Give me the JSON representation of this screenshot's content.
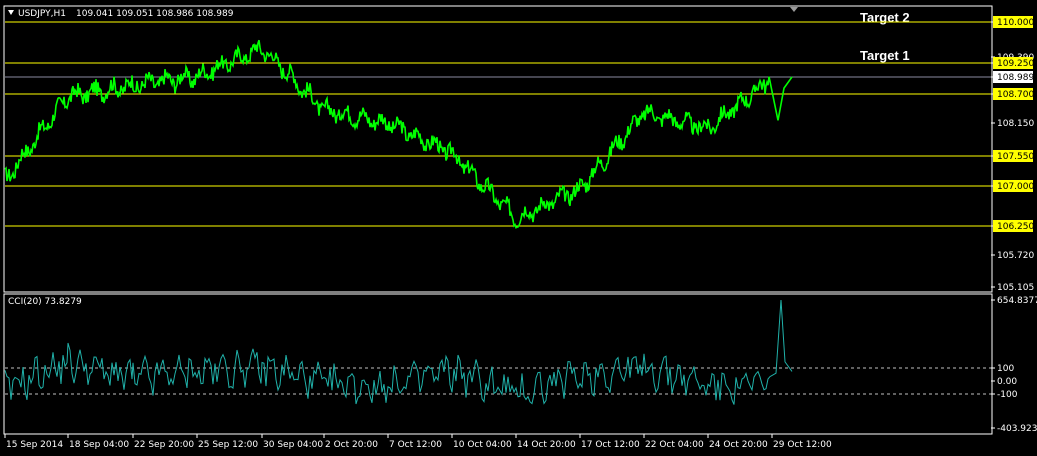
{
  "header": {
    "symbol_label": "USDJPY,H1",
    "ohlc": "109.041 109.051 108.986 108.989"
  },
  "indicator": {
    "label": "CCI(20) 73.8279"
  },
  "annotations": {
    "target1": "Target 1",
    "target2": "Target 2"
  },
  "colors": {
    "price_line": "#00ff00",
    "cci_line": "#20b2aa",
    "level_line": "#ffff00",
    "level_label_bg": "#ffff00",
    "axis": "#ffffff",
    "background": "#000000"
  },
  "chart_data": [
    {
      "type": "line",
      "title": "USDJPY,H1",
      "x": [
        "15 Sep 2014",
        "18 Sep 04:00",
        "22 Sep 20:00",
        "25 Sep 12:00",
        "30 Sep 04:00",
        "2 Oct 20:00",
        "7 Oct 12:00",
        "10 Oct 04:00",
        "14 Oct 20:00",
        "17 Oct 12:00",
        "22 Oct 04:00",
        "24 Oct 20:00",
        "29 Oct 12:00"
      ],
      "series": [
        {
          "values": [
            107.1,
            108.65,
            108.85,
            109.0,
            109.55,
            108.4,
            108.15,
            107.6,
            106.4,
            106.95,
            108.35,
            108.05,
            108.99
          ]
        }
      ],
      "ylim": [
        105.105,
        110.165
      ],
      "y_ticks": [
        "110.000",
        "109.390",
        "109.250",
        "108.989",
        "108.700",
        "108.150",
        "107.550",
        "107.000",
        "106.250",
        "105.720",
        "105.105"
      ],
      "levels": [
        "110.000",
        "109.250",
        "108.700",
        "107.550",
        "107.000",
        "106.250"
      ],
      "current_price": "108.989",
      "last_value": 108.989
    },
    {
      "type": "line",
      "title": "CCI(20) 73.8279",
      "x": [
        "15 Sep 2014",
        "18 Sep 04:00",
        "22 Sep 20:00",
        "25 Sep 12:00",
        "30 Sep 04:00",
        "2 Oct 20:00",
        "7 Oct 12:00",
        "10 Oct 04:00",
        "14 Oct 20:00",
        "17 Oct 12:00",
        "22 Oct 04:00",
        "24 Oct 20:00",
        "29 Oct 12:00"
      ],
      "series": [
        {
          "values": [
            -60,
            150,
            20,
            80,
            110,
            -20,
            -40,
            80,
            -100,
            40,
            110,
            -30,
            654.8377
          ]
        }
      ],
      "ylim": [
        -403.9232,
        654.8377
      ],
      "y_ticks": [
        "654.8377",
        "100",
        "0.00",
        "-100",
        "-403.9232"
      ],
      "levels": [
        100,
        -100
      ],
      "last_value": 73.8279
    }
  ]
}
